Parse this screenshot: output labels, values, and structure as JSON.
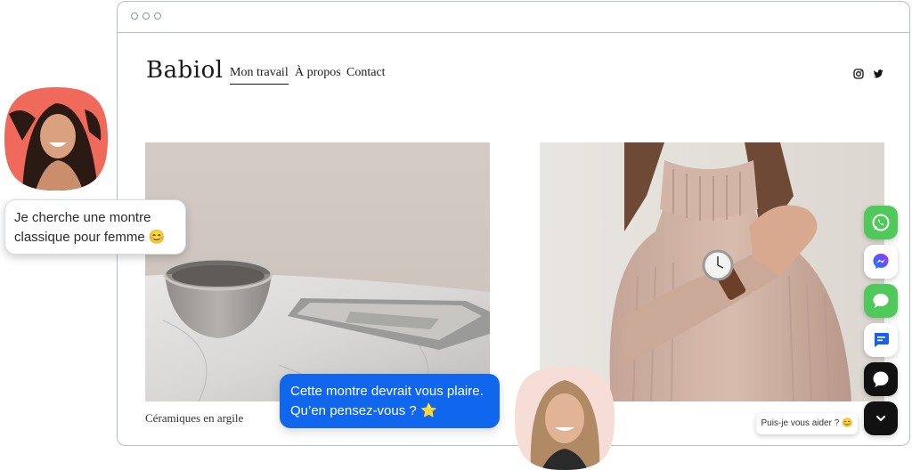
{
  "site": {
    "logo": "Babiol",
    "nav": [
      {
        "label": "Mon travail",
        "active": true
      },
      {
        "label": "À propos",
        "active": false
      },
      {
        "label": "Contact",
        "active": false
      }
    ],
    "social_icons": [
      "instagram-icon",
      "twitter-icon"
    ],
    "gallery": [
      {
        "caption": "Céramiques en argile",
        "image": "ceramic-bowl-and-tray-photo"
      },
      {
        "caption": "",
        "image": "woman-wearing-watch-photo"
      }
    ]
  },
  "chat": {
    "customer_message": "Je cherche une montre classique pour femme",
    "customer_emoji": "😊",
    "agent_message": "Cette montre devrait vous plaire. Qu’en pensez-vous ?",
    "agent_emoji": "⭐",
    "help_label": "Puis-je vous aider ?",
    "help_emoji": "😊",
    "channels": [
      {
        "name": "whatsapp",
        "color": "#4ec95a"
      },
      {
        "name": "messenger",
        "color": "#ffffff"
      },
      {
        "name": "imessage",
        "color": "#4ec95a"
      },
      {
        "name": "sms-chat",
        "color": "#ffffff"
      },
      {
        "name": "live-chat",
        "color": "#111111"
      }
    ]
  },
  "colors": {
    "accent_blue": "#1166ee",
    "avatar_left_bg": "#f06a5b",
    "avatar_right_bg": "#f6ddd6"
  }
}
